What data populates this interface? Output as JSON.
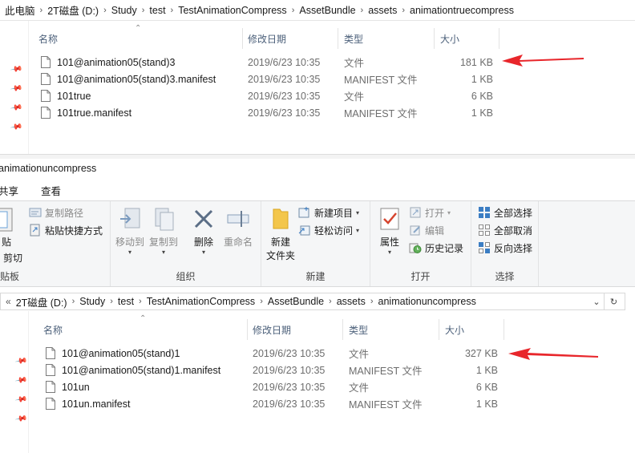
{
  "top": {
    "breadcrumb": [
      "此电脑",
      "2T磁盘 (D:)",
      "Study",
      "test",
      "TestAnimationCompress",
      "AssetBundle",
      "assets",
      "animationtruecompress"
    ],
    "columns": {
      "name": "名称",
      "date": "修改日期",
      "type": "类型",
      "size": "大小"
    },
    "files": [
      {
        "name": "101@animation05(stand)3",
        "date": "2019/6/23 10:35",
        "type": "文件",
        "size": "181 KB"
      },
      {
        "name": "101@animation05(stand)3.manifest",
        "date": "2019/6/23 10:35",
        "type": "MANIFEST 文件",
        "size": "1 KB"
      },
      {
        "name": "101true",
        "date": "2019/6/23 10:35",
        "type": "文件",
        "size": "6 KB"
      },
      {
        "name": "101true.manifest",
        "date": "2019/6/23 10:35",
        "type": "MANIFEST 文件",
        "size": "1 KB"
      }
    ]
  },
  "bottom": {
    "title": "animationuncompress",
    "menu": {
      "share": "共享",
      "view": "查看"
    },
    "ribbon": {
      "clipboard": {
        "label": "贴板",
        "paste": "贴",
        "cut": "剪切",
        "copy_path": "复制路径",
        "paste_shortcut": "粘贴快捷方式"
      },
      "organize": {
        "label": "组织",
        "move_to": "移动到",
        "copy_to": "复制到",
        "delete": "删除",
        "rename": "重命名"
      },
      "new": {
        "label": "新建",
        "new_folder_line1": "新建",
        "new_folder_line2": "文件夹",
        "new_item": "新建项目",
        "easy_access": "轻松访问"
      },
      "open": {
        "label": "打开",
        "properties": "属性",
        "open": "打开",
        "edit": "编辑",
        "history": "历史记录"
      },
      "select": {
        "label": "选择",
        "select_all": "全部选择",
        "select_none": "全部取消",
        "invert": "反向选择"
      }
    },
    "breadcrumb": [
      "2T磁盘 (D:)",
      "Study",
      "test",
      "TestAnimationCompress",
      "AssetBundle",
      "assets",
      "animationuncompress"
    ],
    "breadcrumb_prefix": "«",
    "columns": {
      "name": "名称",
      "date": "修改日期",
      "type": "类型",
      "size": "大小"
    },
    "files": [
      {
        "name": "101@animation05(stand)1",
        "date": "2019/6/23 10:35",
        "type": "文件",
        "size": "327 KB"
      },
      {
        "name": "101@animation05(stand)1.manifest",
        "date": "2019/6/23 10:35",
        "type": "MANIFEST 文件",
        "size": "1 KB"
      },
      {
        "name": "101un",
        "date": "2019/6/23 10:35",
        "type": "文件",
        "size": "6 KB"
      },
      {
        "name": "101un.manifest",
        "date": "2019/6/23 10:35",
        "type": "MANIFEST 文件",
        "size": "1 KB"
      }
    ]
  },
  "colors": {
    "annotation_arrow": "#e8262b",
    "header_text": "#4c607a"
  }
}
